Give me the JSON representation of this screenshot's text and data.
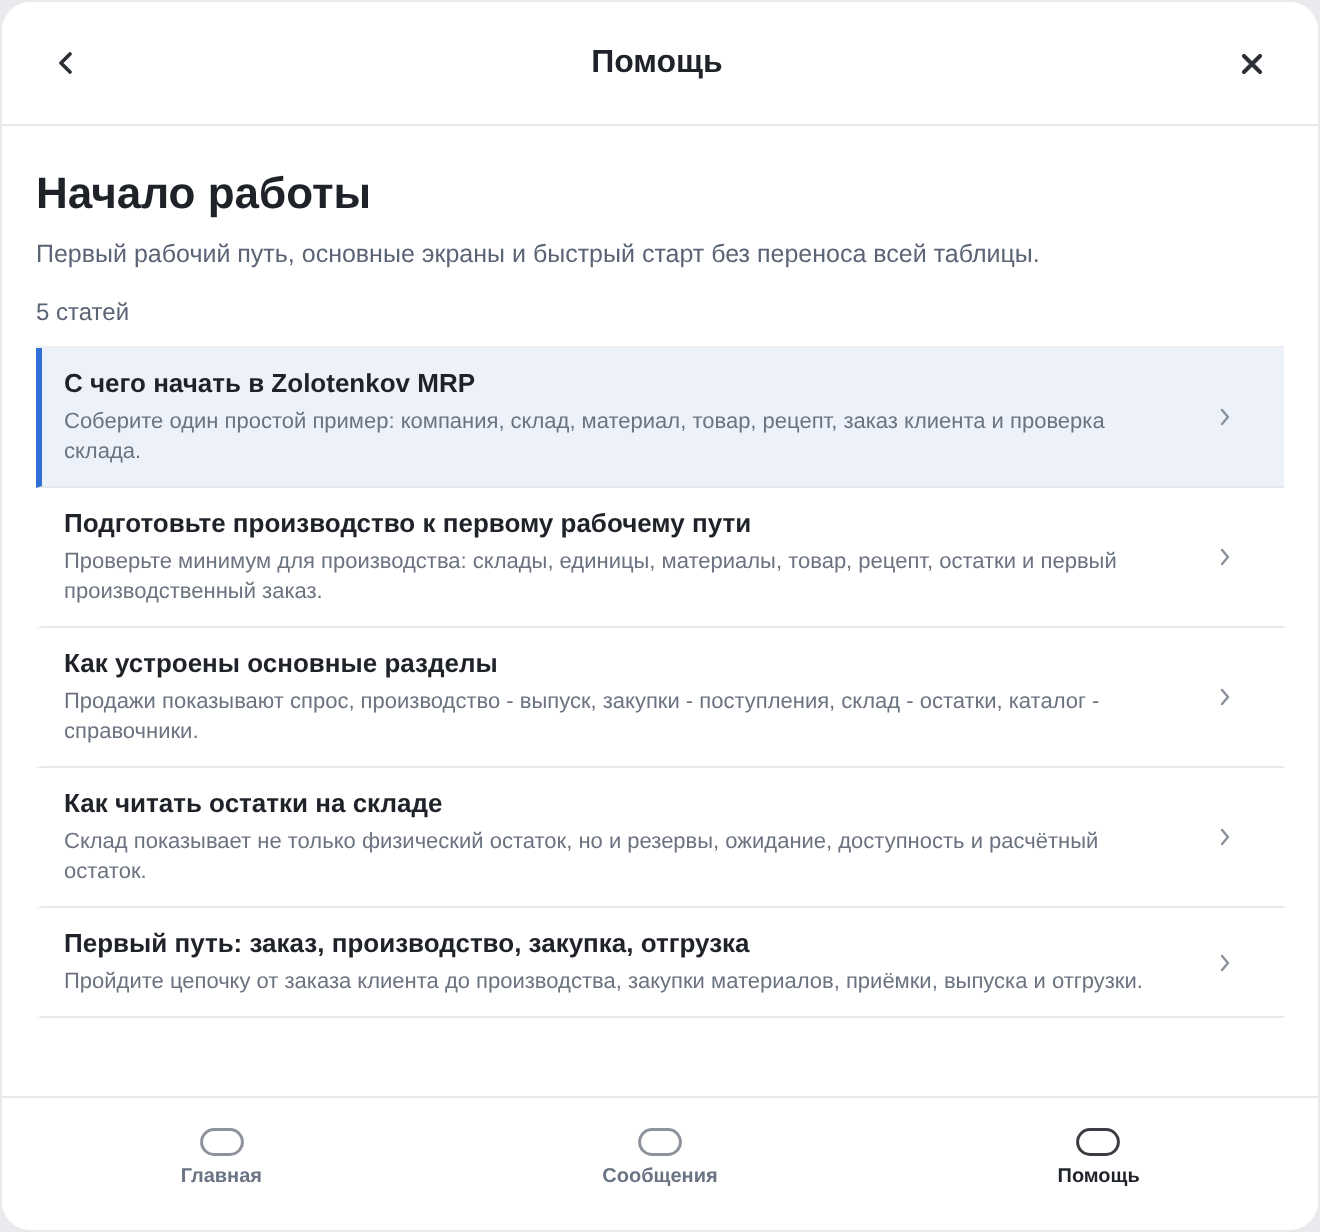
{
  "header": {
    "title": "Помощь"
  },
  "section": {
    "title": "Начало работы",
    "subtitle": "Первый рабочий путь, основные экраны и быстрый старт без переноса всей таблицы.",
    "count": "5 статей"
  },
  "articles": [
    {
      "title": "С чего начать в Zolotenkov MRP",
      "description": "Соберите один простой пример: компания, склад, материал, товар, рецепт, заказ клиента и проверка склада.",
      "selected": true
    },
    {
      "title": "Подготовьте производство к первому рабочему пути",
      "description": "Проверьте минимум для производства: склады, единицы, материалы, товар, рецепт, остатки и первый производственный заказ.",
      "selected": false
    },
    {
      "title": "Как устроены основные разделы",
      "description": "Продажи показывают спрос, производство - выпуск, закупки - поступления, склад - остатки, каталог - справочники.",
      "selected": false
    },
    {
      "title": "Как читать остатки на складе",
      "description": "Склад показывает не только физический остаток, но и резервы, ожидание, доступность и расчётный остаток.",
      "selected": false
    },
    {
      "title": "Первый путь: заказ, производство, закупка, отгрузка",
      "description": "Пройдите цепочку от заказа клиента до производства, закупки материалов, приёмки, выпуска и отгрузки.",
      "selected": false
    }
  ],
  "tabs": [
    {
      "label": "Главная",
      "selected": false
    },
    {
      "label": "Сообщения",
      "selected": false
    },
    {
      "label": "Помощь",
      "selected": true
    }
  ]
}
